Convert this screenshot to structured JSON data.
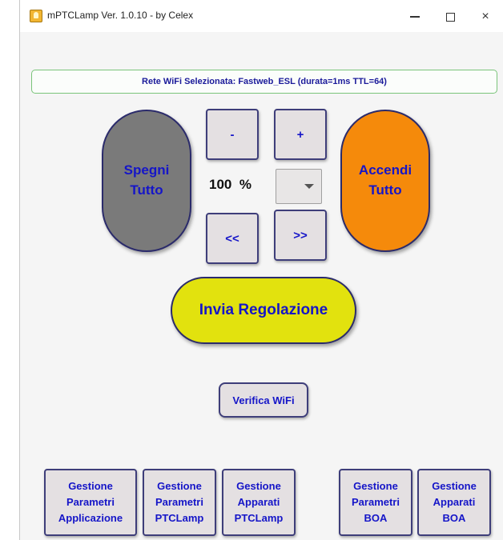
{
  "window": {
    "title": "mPTCLamp Ver. 1.0.10 - by Celex",
    "icon": "lamp-app-icon",
    "controls": {
      "minimize": "minimize-icon",
      "maximize": "maximize-icon",
      "close": "×"
    }
  },
  "wifi_banner": {
    "text": "Rete WiFi Selezionata: Fastweb_ESL (durata=1ms TTL=64)",
    "border_color": "#7ac47a"
  },
  "controls": {
    "all_off": {
      "line1": "Spegni",
      "line2": "Tutto",
      "color": "#7a7a7a"
    },
    "all_on": {
      "line1": "Accendi",
      "line2": "Tutto",
      "color": "#f58a0b"
    },
    "minus_label": "-",
    "plus_label": "+",
    "rewind_label": "<<",
    "forward_label": ">>",
    "percent_value": "100",
    "percent_unit": "%",
    "dropdown_value": ""
  },
  "send_button": {
    "label": "Invia Regolazione",
    "color": "#e2e20e"
  },
  "verify_button": {
    "label": "Verifica WiFi"
  },
  "management": [
    {
      "line1": "Gestione",
      "line2": "Parametri",
      "line3": "Applicazione"
    },
    {
      "line1": "Gestione",
      "line2": "Parametri",
      "line3": "PTCLamp"
    },
    {
      "line1": "Gestione",
      "line2": "Apparati",
      "line3": "PTCLamp"
    },
    {
      "line1": "Gestione",
      "line2": "Parametri",
      "line3": "BOA"
    },
    {
      "line1": "Gestione",
      "line2": "Apparati",
      "line3": "BOA"
    }
  ],
  "colors": {
    "button_text": "#1515c8",
    "button_border": "#3e3e7a"
  }
}
